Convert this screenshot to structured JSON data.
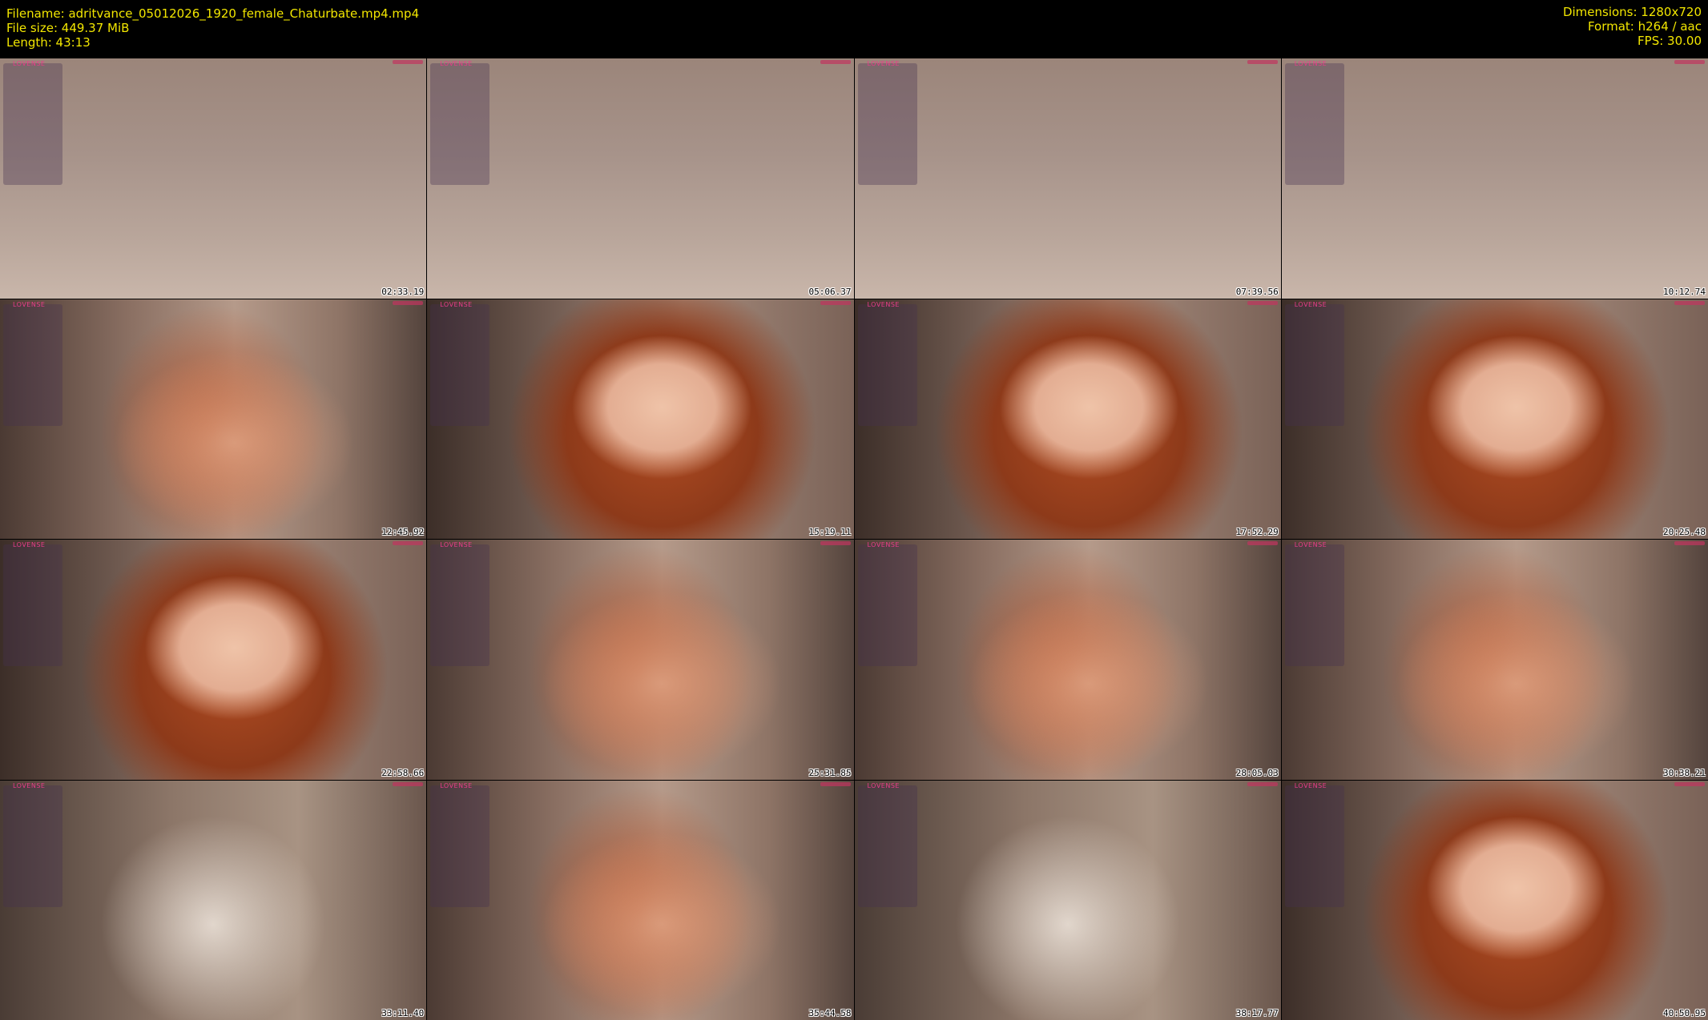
{
  "header": {
    "filename": "Filename: adritvance_05012026_1920_female_Chaturbate.mp4.mp4",
    "filesize": "File size: 449.37 MiB",
    "length": "Length: 43:13",
    "dimensions": "Dimensions: 1280x720",
    "format": "Format: h264 / aac",
    "fps": "FPS: 30.00"
  },
  "overlay_brand": "LOVENSE",
  "thumbnails": [
    {
      "time": "02:33.19",
      "scene": "blank"
    },
    {
      "time": "05:06.37",
      "scene": "blank"
    },
    {
      "time": "07:39.56",
      "scene": "blank"
    },
    {
      "time": "10:12.74",
      "scene": "blank"
    },
    {
      "time": "12:45.92",
      "scene": "room"
    },
    {
      "time": "15:19.11",
      "scene": "face"
    },
    {
      "time": "17:52.29",
      "scene": "face"
    },
    {
      "time": "20:25.48",
      "scene": "face"
    },
    {
      "time": "22:58.66",
      "scene": "face"
    },
    {
      "time": "25:31.85",
      "scene": "room"
    },
    {
      "time": "28:05.03",
      "scene": "room"
    },
    {
      "time": "30:38.21",
      "scene": "room"
    },
    {
      "time": "33:11.40",
      "scene": "light"
    },
    {
      "time": "35:44.58",
      "scene": "room"
    },
    {
      "time": "38:17.77",
      "scene": "light"
    },
    {
      "time": "40:50.95",
      "scene": "face"
    }
  ]
}
